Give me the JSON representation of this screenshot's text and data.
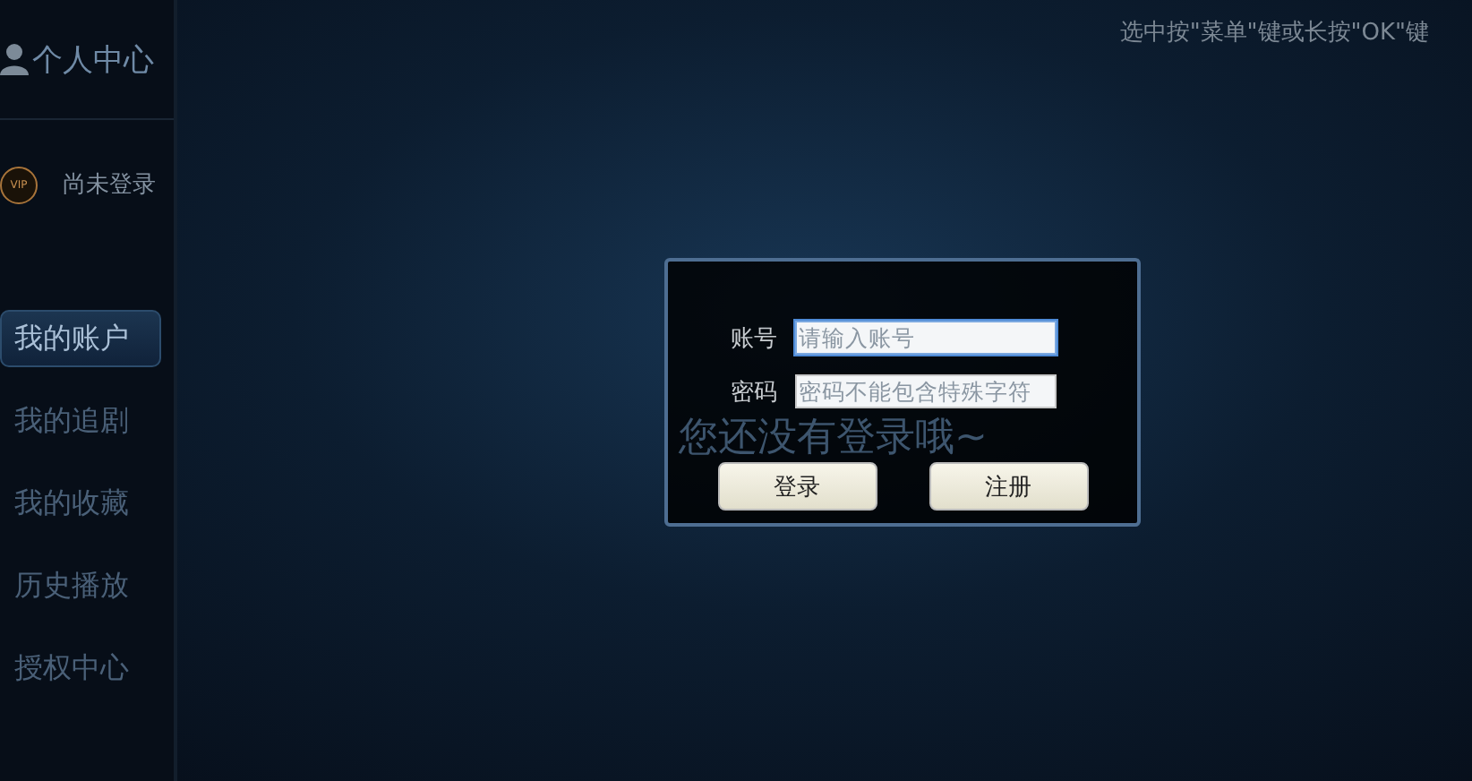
{
  "sidebar": {
    "title": "个人中心",
    "user_status": "尚未登录",
    "vip_badge": "VIP",
    "items": [
      {
        "label": "我的账户",
        "selected": true
      },
      {
        "label": "我的追剧",
        "selected": false
      },
      {
        "label": "我的收藏",
        "selected": false
      },
      {
        "label": "历史播放",
        "selected": false
      },
      {
        "label": "授权中心",
        "selected": false
      }
    ]
  },
  "hint": "选中按\"菜单\"键或长按\"OK\"键",
  "empty_message": "您还没有登录哦~",
  "login_dialog": {
    "fields": [
      {
        "label": "账号",
        "placeholder": "请输入账号",
        "focused": true
      },
      {
        "label": "密码",
        "placeholder": "密码不能包含特殊字符",
        "focused": false
      }
    ],
    "buttons": [
      "登录",
      "注册"
    ]
  }
}
